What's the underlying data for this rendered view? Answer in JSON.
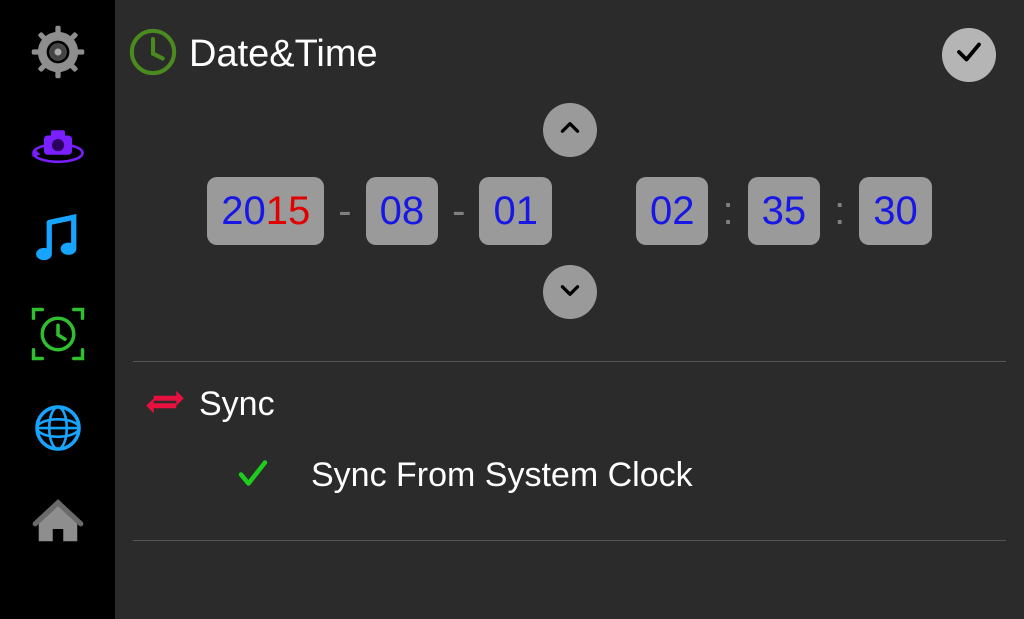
{
  "header": {
    "title": "Date&Time"
  },
  "datetime": {
    "year": "2015",
    "year_blue": "20",
    "year_red": "15",
    "month": "08",
    "day": "01",
    "hour": "02",
    "minute": "35",
    "second": "30",
    "sep_date": "-",
    "sep_time": ":"
  },
  "sync": {
    "title": "Sync",
    "option_label": "Sync From System Clock",
    "option_checked": true
  },
  "sidebar": {
    "items": [
      {
        "name": "settings"
      },
      {
        "name": "camera-rotate"
      },
      {
        "name": "music"
      },
      {
        "name": "clock",
        "active": true
      },
      {
        "name": "globe"
      },
      {
        "name": "home"
      }
    ]
  },
  "colors": {
    "blue": "#1717e6",
    "red": "#e00000",
    "sidebar_purple": "#7a1fff",
    "sidebar_blue": "#17a4ff",
    "sidebar_green": "#2fbf2f",
    "sidebar_crimson": "#e8103f",
    "sidebar_gray": "#8e8e8e"
  }
}
